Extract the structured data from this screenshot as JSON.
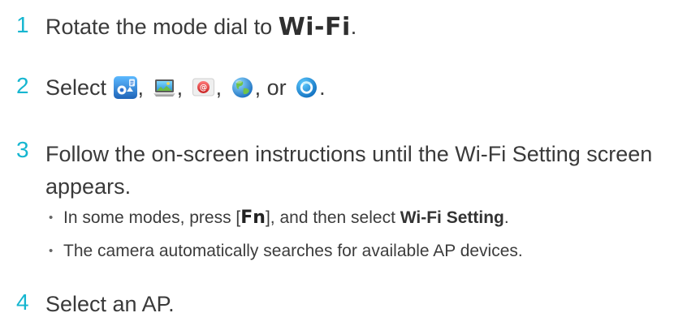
{
  "steps": [
    {
      "number": "1",
      "text_before": "Rotate the mode dial to ",
      "mode_label": "Wi-Fi",
      "text_after": "."
    },
    {
      "number": "2",
      "text_before": "Select ",
      "separators": [
        ",",
        ",",
        ",",
        ", or"
      ],
      "text_after": ".",
      "icons": [
        {
          "name": "smart-camera-app-icon"
        },
        {
          "name": "photo-viewer-on-laptop-icon"
        },
        {
          "name": "email-icon"
        },
        {
          "name": "globe-sns-icon"
        },
        {
          "name": "cloud-sync-icon"
        }
      ]
    },
    {
      "number": "3",
      "text": "Follow the on-screen instructions until the Wi-Fi Setting screen appears.",
      "bullets": [
        {
          "prefix": "In some modes, press [",
          "key_label": "Fn",
          "middle": "], and then select ",
          "bold": "Wi-Fi Setting",
          "suffix": "."
        },
        {
          "text": "The camera automatically searches for available AP devices."
        }
      ]
    },
    {
      "number": "4",
      "text": "Select an AP."
    }
  ],
  "colors": {
    "step_number": "#16b6d0",
    "body_text": "#3a3a3a"
  }
}
